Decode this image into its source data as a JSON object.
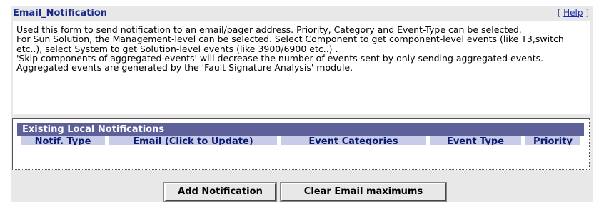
{
  "form": {
    "title": "Email_Notification",
    "help_open": "[ ",
    "help_label": "Help",
    "help_close": " ]"
  },
  "description": {
    "line1": "Used this form to send notification to an email/pager address. Priority, Category and Event-Type can be selected.",
    "line2": "For Sun Solution, the Management-level can be selected. Select Component to get component-level events (like T3,switch etc..), select System to get Solution-level events (like 3900/6900 etc..) .",
    "line3": "'Skip components of aggregated events' will decrease the number of events sent by only sending aggregated events. Aggregated events are generated by the 'Fault Signature Analysis' module."
  },
  "table": {
    "title": "Existing Local Notifications",
    "columns": [
      "Notif. Type",
      "Email (Click to Update)",
      "Event Categories",
      "Event Type",
      "Priority"
    ]
  },
  "buttons": {
    "add_label": "Add Notification",
    "clear_label": "Clear Email maximums"
  },
  "colors": {
    "title": "#1a2b8c",
    "table_header_bg": "#5e6099",
    "column_header_bg": "#c8cce8",
    "panel_bg": "#e8e8e8"
  }
}
